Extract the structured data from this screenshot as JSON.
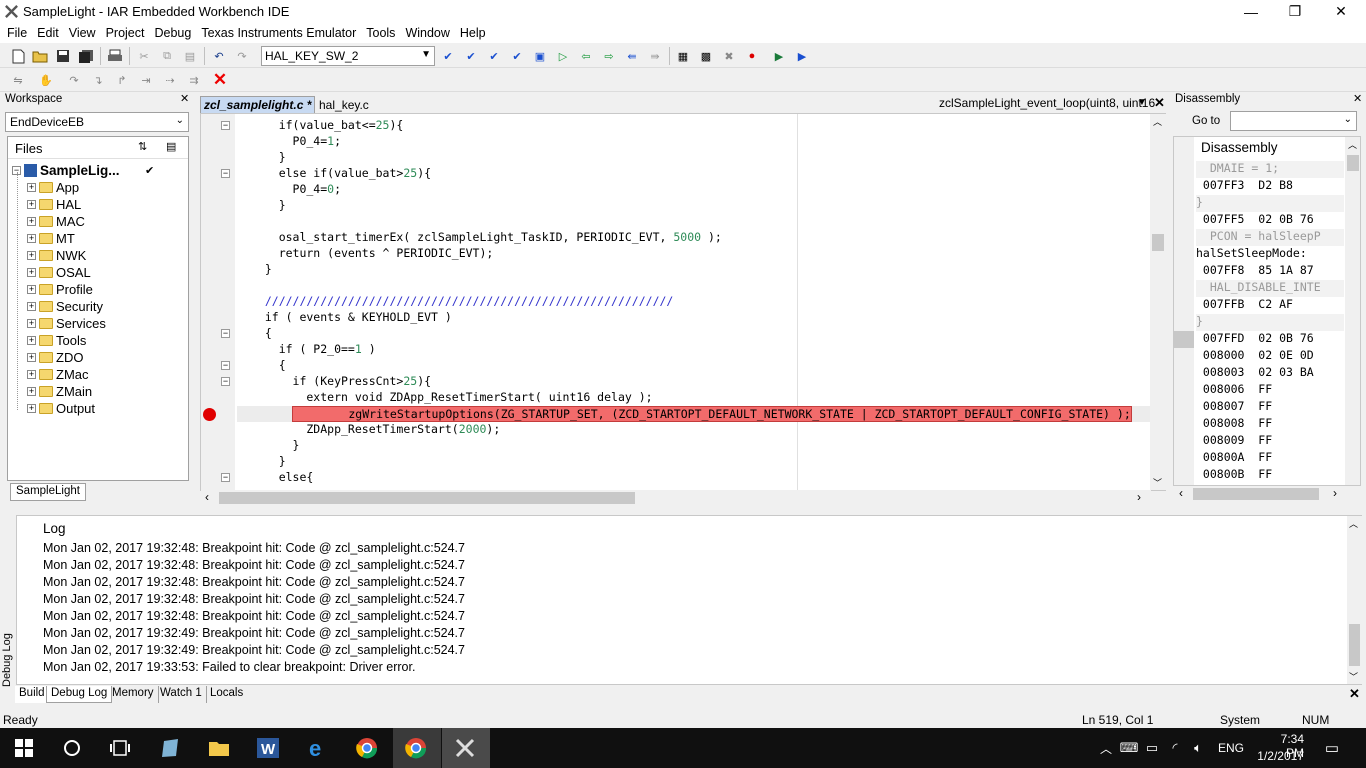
{
  "window": {
    "title": "SampleLight - IAR Embedded Workbench IDE",
    "minimize": "—",
    "restore": "❐",
    "close": "✕"
  },
  "menu": [
    "File",
    "Edit",
    "View",
    "Project",
    "Debug",
    "Texas Instruments Emulator",
    "Tools",
    "Window",
    "Help"
  ],
  "toolbar": {
    "combo_value": "HAL_KEY_SW_2"
  },
  "workspace": {
    "header": "Workspace",
    "config": "EndDeviceEB",
    "files_header": "Files",
    "root": "SampleLig...",
    "root_check": "✔",
    "folders": [
      "App",
      "HAL",
      "MAC",
      "MT",
      "NWK",
      "OSAL",
      "Profile",
      "Security",
      "Services",
      "Tools",
      "ZDO",
      "ZMac",
      "ZMain",
      "Output"
    ],
    "tab": "SampleLight"
  },
  "editor": {
    "tabs": [
      "zcl_samplelight.c *",
      "hal_key.c"
    ],
    "function_combo": "zclSampleLight_event_loop(uint8, uint16",
    "lines": [
      "    if(value_bat<=25){",
      "      P0_4=1;",
      "    }",
      "    else if(value_bat>25){",
      "      P0_4=0;",
      "    }",
      "",
      "    osal_start_timerEx( zclSampleLight_TaskID, PERIODIC_EVT, 5000 );",
      "    return (events ^ PERIODIC_EVT);",
      "  }",
      "",
      "  ///////////////////////////////////////////////////////////",
      "  if ( events & KEYHOLD_EVT )",
      "  {",
      "    if ( P2_0==1 )",
      "    {",
      "      if (KeyPressCnt>25){",
      "        extern void ZDApp_ResetTimerStart( uint16 delay );",
      "        zgWriteStartupOptions(ZG_STARTUP_SET, (ZCD_STARTOPT_DEFAULT_NETWORK_STATE | ZCD_STARTOPT_DEFAULT_CONFIG_STATE) );",
      "        ZDApp_ResetTimerStart(2000);",
      "      }",
      "    }",
      "    else{"
    ]
  },
  "disassembly": {
    "header": "Disassembly",
    "goto_label": "Go to",
    "title": "Disassembly",
    "lines": [
      "  DMAIE = 1;",
      " 007FF3  D2 B8",
      "}",
      " 007FF5  02 0B 76",
      "  PCON = halSleepP",
      "halSetSleepMode:",
      " 007FF8  85 1A 87",
      "  HAL_DISABLE_INTE",
      " 007FFB  C2 AF",
      "}",
      " 007FFD  02 0B 76",
      " 008000  02 0E 0D",
      " 008003  02 03 BA",
      " 008006  FF",
      " 008007  FF",
      " 008008  FF",
      " 008009  FF",
      " 00800A  FF",
      " 00800B  FF"
    ]
  },
  "log": {
    "header": "Log",
    "side_label": "Debug Log",
    "lines": [
      "Mon Jan 02, 2017 19:32:48: Breakpoint hit: Code @ zcl_samplelight.c:524.7",
      "Mon Jan 02, 2017 19:32:48: Breakpoint hit: Code @ zcl_samplelight.c:524.7",
      "Mon Jan 02, 2017 19:32:48: Breakpoint hit: Code @ zcl_samplelight.c:524.7",
      "Mon Jan 02, 2017 19:32:48: Breakpoint hit: Code @ zcl_samplelight.c:524.7",
      "Mon Jan 02, 2017 19:32:48: Breakpoint hit: Code @ zcl_samplelight.c:524.7",
      "Mon Jan 02, 2017 19:32:49: Breakpoint hit: Code @ zcl_samplelight.c:524.7",
      "Mon Jan 02, 2017 19:32:49: Breakpoint hit: Code @ zcl_samplelight.c:524.7",
      "Mon Jan 02, 2017 19:33:53: Failed to clear breakpoint: Driver error."
    ],
    "tabs": [
      "Build",
      "Debug Log",
      "Memory",
      "Watch 1",
      "Locals"
    ]
  },
  "status": {
    "left": "Ready",
    "position": "Ln 519, Col 1",
    "mode": "System",
    "num": "NUM"
  },
  "taskbar": {
    "lang": "ENG",
    "time": "7:34 PM",
    "date": "1/2/2017"
  },
  "colors": {
    "breakpoint_line": "#f26b6b",
    "breakpoint_dot": "#e00000",
    "active_tab": "#c8daf2"
  }
}
